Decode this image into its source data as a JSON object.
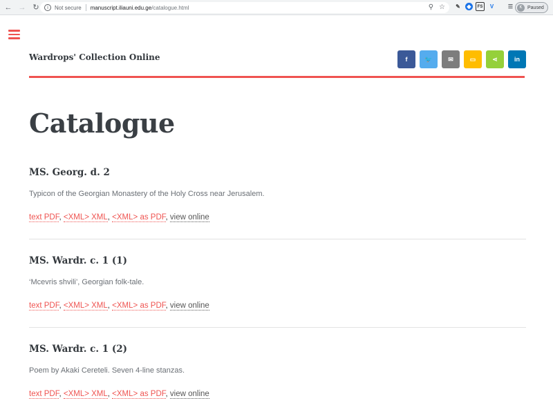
{
  "browser": {
    "secure_label": "Not secure",
    "url_host": "manuscript.iliauni.edu.ge",
    "url_path": "/catalogue.html",
    "profile_initial": "K",
    "profile_status": "Paused",
    "icons": [
      "back-icon",
      "forward-icon",
      "reload-icon",
      "info-icon",
      "zoom-icon",
      "star-icon"
    ]
  },
  "site": {
    "title": "Wardrops' Collection Online",
    "share_icons": [
      {
        "name": "facebook",
        "glyph": "f",
        "color": "#3b5998"
      },
      {
        "name": "twitter",
        "glyph": "🐦",
        "color": "#55acee"
      },
      {
        "name": "email",
        "glyph": "✉",
        "color": "#7d7d7d"
      },
      {
        "name": "sms",
        "glyph": "▭",
        "color": "#ffbd00"
      },
      {
        "name": "share",
        "glyph": "⋖",
        "color": "#95d03a"
      },
      {
        "name": "linkedin",
        "glyph": "in",
        "color": "#0077b5"
      }
    ],
    "accent": "#ef5350"
  },
  "page": {
    "title": "Catalogue"
  },
  "entries": [
    {
      "title": "MS. Georg. d. 2",
      "description": "Typicon of the Georgian Monastery of the Holy Cross near Jerusalem.",
      "links": {
        "pdf": "text PDF",
        "xml": "<XML> XML",
        "xml_pdf": "<XML> as PDF",
        "online": "view online"
      }
    },
    {
      "title": "MS. Wardr. c. 1 (1)",
      "description": "‘Mcevris shvili’, Georgian folk-tale.",
      "links": {
        "pdf": "text PDF",
        "xml": "<XML> XML",
        "xml_pdf": "<XML> as PDF",
        "online": "view online"
      }
    },
    {
      "title": "MS. Wardr. c. 1 (2)",
      "description": "Poem by Akaki Cereteli. Seven 4-line stanzas.",
      "links": {
        "pdf": "text PDF",
        "xml": "<XML> XML",
        "xml_pdf": "<XML> as PDF",
        "online": "view online"
      }
    }
  ]
}
